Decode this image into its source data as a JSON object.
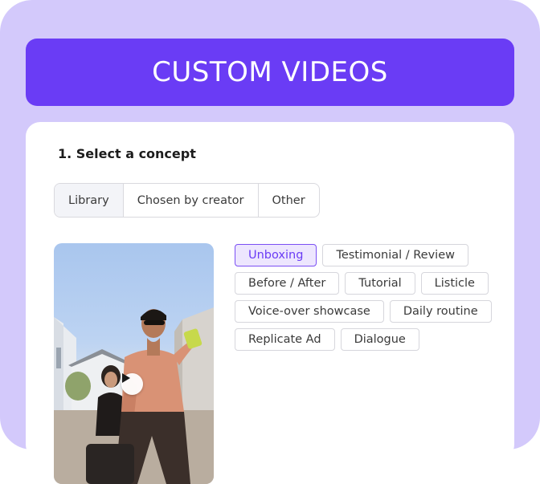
{
  "header": {
    "title": "CUSTOM VIDEOS"
  },
  "concept": {
    "step_title": "1. Select a concept",
    "source_tabs": [
      {
        "label": "Library",
        "selected": true
      },
      {
        "label": "Chosen by creator",
        "selected": false
      },
      {
        "label": "Other",
        "selected": false
      }
    ],
    "tags": [
      [
        {
          "label": "Unboxing",
          "selected": true
        },
        {
          "label": "Testimonial / Review",
          "selected": false
        }
      ],
      [
        {
          "label": "Before / After",
          "selected": false
        },
        {
          "label": "Tutorial",
          "selected": false
        },
        {
          "label": "Listicle",
          "selected": false
        }
      ],
      [
        {
          "label": "Voice-over showcase",
          "selected": false
        },
        {
          "label": "Daily routine",
          "selected": false
        }
      ],
      [
        {
          "label": "Replicate Ad",
          "selected": false
        },
        {
          "label": "Dialogue",
          "selected": false
        }
      ]
    ]
  },
  "video": {
    "icon": "play-icon"
  },
  "colors": {
    "background": "#d3c9fb",
    "accent": "#6a3cf5",
    "selected_tag_bg": "#ede6fe",
    "selected_tag_border": "#7b4ff4"
  }
}
